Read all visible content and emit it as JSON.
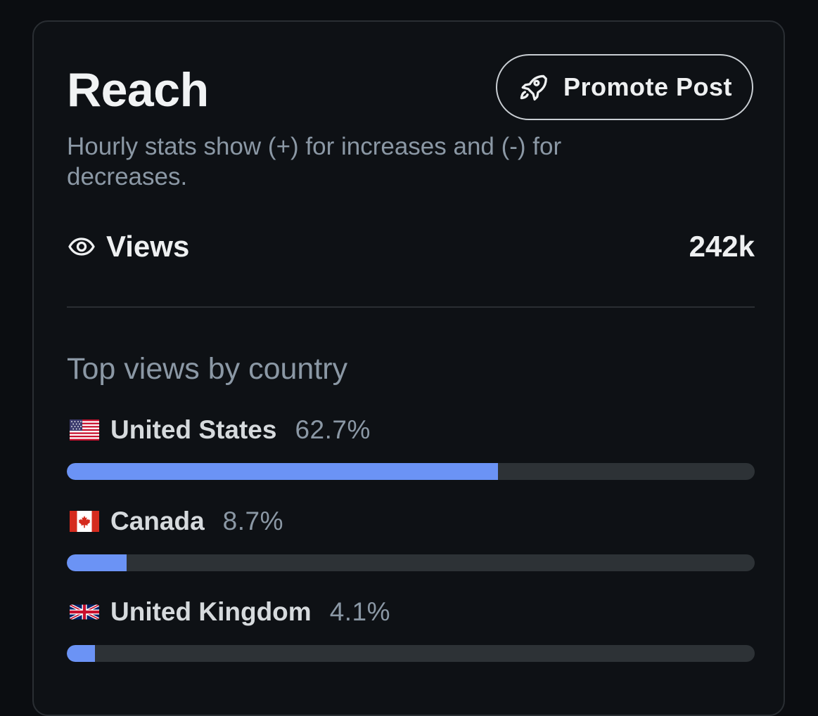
{
  "card": {
    "title": "Reach",
    "subtitle": "Hourly stats show (+) for increases and (-) for decreases.",
    "promote_button": {
      "label": "Promote Post",
      "icon": "rocket-icon"
    },
    "views": {
      "icon": "eye-icon",
      "label": "Views",
      "value": "242k"
    },
    "top_countries": {
      "title": "Top views by country",
      "items": [
        {
          "flag": "us-flag-icon",
          "name": "United States",
          "percent_label": "62.7%",
          "percent": 62.7
        },
        {
          "flag": "ca-flag-icon",
          "name": "Canada",
          "percent_label": "8.7%",
          "percent": 8.7
        },
        {
          "flag": "uk-flag-icon",
          "name": "United Kingdom",
          "percent_label": "4.1%",
          "percent": 4.1
        }
      ]
    }
  },
  "colors": {
    "background": "#0b0d11",
    "card_background": "#0e1115",
    "bar_fill": "#6b93f5",
    "bar_track": "#2d3236",
    "muted_text": "#8b98a5"
  }
}
